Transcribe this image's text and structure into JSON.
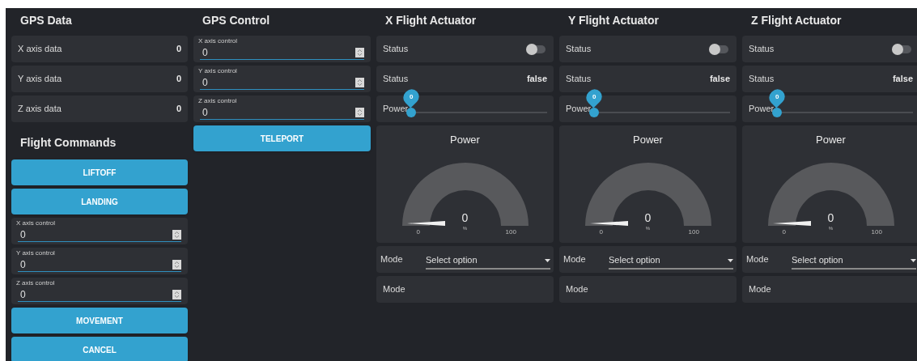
{
  "gps_data": {
    "title": "GPS Data",
    "items": [
      {
        "label": "X axis data",
        "value": "0"
      },
      {
        "label": "Y axis data",
        "value": "0"
      },
      {
        "label": "Z axis data",
        "value": "0"
      }
    ]
  },
  "gps_control": {
    "title": "GPS Control",
    "inputs": [
      {
        "label": "X axis control",
        "value": "0"
      },
      {
        "label": "Y axis control",
        "value": "0"
      },
      {
        "label": "Z axis control",
        "value": "0"
      }
    ],
    "button": "TELEPORT"
  },
  "flight_commands": {
    "title": "Flight Commands",
    "items": [
      {
        "kind": "button",
        "label": "LIFTOFF"
      },
      {
        "kind": "button",
        "label": "LANDING"
      },
      {
        "kind": "input",
        "label": "X axis control",
        "value": "0"
      },
      {
        "kind": "input",
        "label": "Y axis control",
        "value": "0"
      },
      {
        "kind": "input",
        "label": "Z axis control",
        "value": "0"
      },
      {
        "kind": "button",
        "label": "MOVEMENT"
      },
      {
        "kind": "button",
        "label": "CANCEL"
      }
    ]
  },
  "actuators": [
    {
      "title": "X Flight Actuator",
      "switch": {
        "label": "Status",
        "on": false
      },
      "status": {
        "label": "Status",
        "value": "false"
      },
      "slider": {
        "label": "Power",
        "value": "0",
        "level": 0
      },
      "gauge": {
        "title": "Power",
        "value": "0",
        "unit": "%",
        "min": "0",
        "max": "100"
      },
      "select": {
        "label": "Mode",
        "value": "Select option"
      },
      "text": {
        "label": "Mode"
      }
    },
    {
      "title": "Y Flight Actuator",
      "switch": {
        "label": "Status",
        "on": false
      },
      "status": {
        "label": "Status",
        "value": "false"
      },
      "slider": {
        "label": "Power",
        "value": "0",
        "level": 0
      },
      "gauge": {
        "title": "Power",
        "value": "0",
        "unit": "%",
        "min": "0",
        "max": "100"
      },
      "select": {
        "label": "Mode",
        "value": "Select option"
      },
      "text": {
        "label": "Mode"
      }
    },
    {
      "title": "Z Flight Actuator",
      "switch": {
        "label": "Status",
        "on": false
      },
      "status": {
        "label": "Status",
        "value": "false"
      },
      "slider": {
        "label": "Power",
        "value": "0",
        "level": 0
      },
      "gauge": {
        "title": "Power",
        "value": "0",
        "unit": "%",
        "min": "0",
        "max": "100"
      },
      "select": {
        "label": "Mode",
        "value": "Select option"
      },
      "text": {
        "label": "Mode"
      }
    }
  ]
}
